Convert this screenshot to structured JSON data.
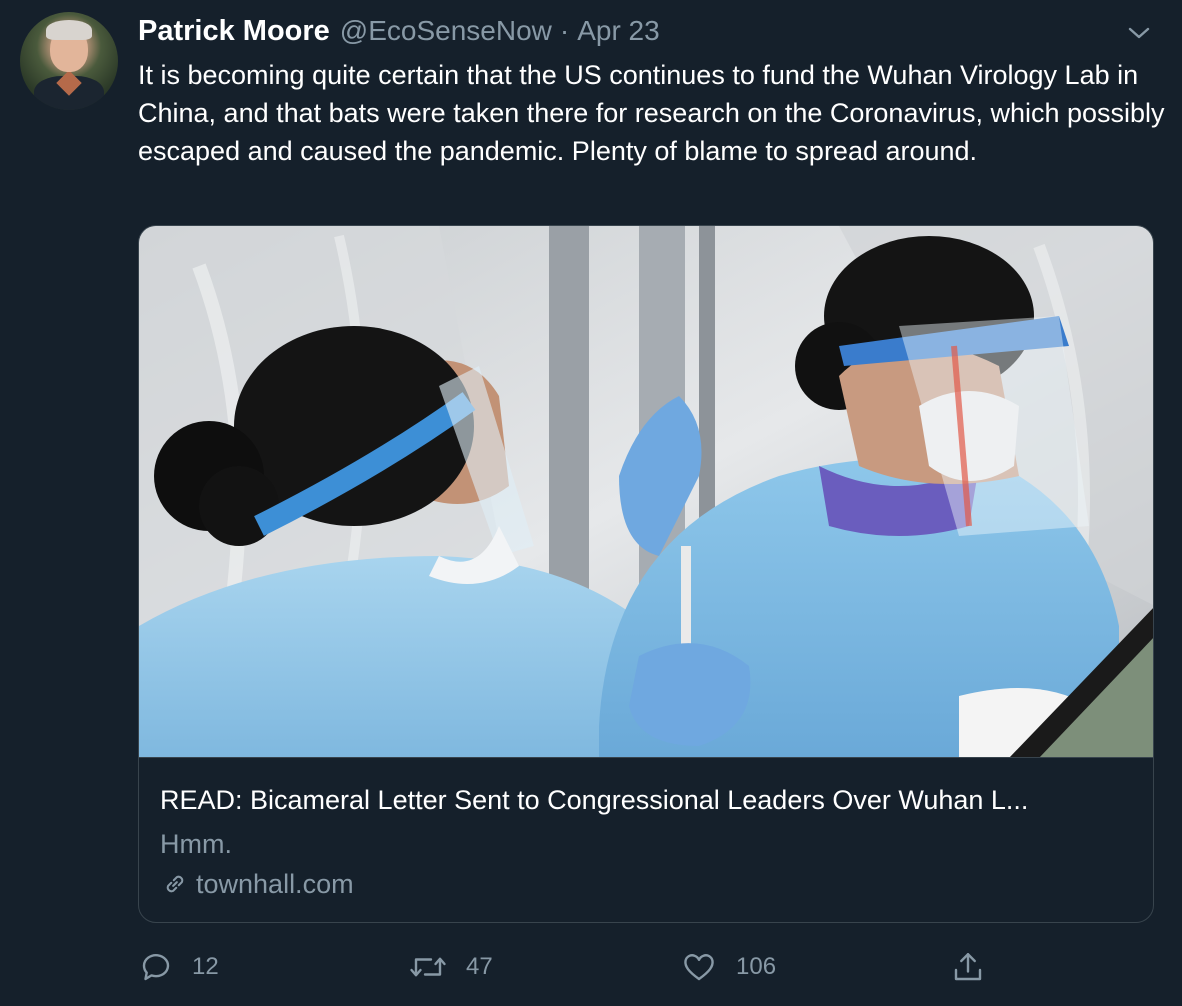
{
  "tweet": {
    "author_name": "Patrick Moore",
    "handle": "@EcoSenseNow",
    "separator": "·",
    "date": "Apr 23",
    "text": "It is becoming quite certain that the US continues to fund the Wuhan Virology Lab in China, and that bats were taken there for research on the Coronavirus, which possibly  escaped and caused the pandemic. Plenty of blame to spread around."
  },
  "card": {
    "image_icon": "photo-of-health-workers-in-ppe",
    "title": "READ: Bicameral Letter Sent to Congressional Leaders Over Wuhan L...",
    "description": "Hmm.",
    "domain": "townhall.com",
    "domain_icon": "link-icon"
  },
  "actions": {
    "reply_count": "12",
    "retweet_count": "47",
    "like_count": "106",
    "icons": [
      "reply-icon",
      "retweet-icon",
      "like-icon",
      "share-icon"
    ]
  },
  "colors": {
    "background": "#15202b",
    "text_primary": "#ffffff",
    "text_secondary": "#8899a6",
    "border": "#38444d"
  }
}
